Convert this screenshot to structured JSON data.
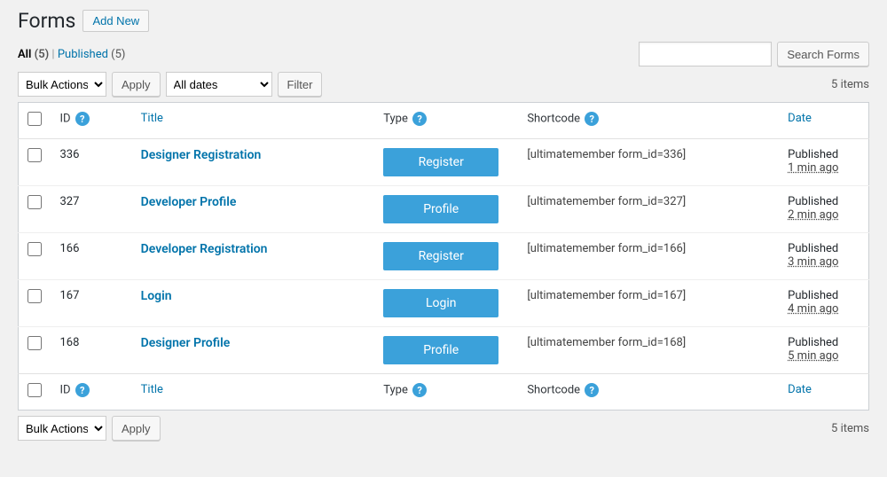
{
  "header": {
    "title": "Forms",
    "add_new": "Add New"
  },
  "status": {
    "all_label": "All",
    "all_count": "(5)",
    "published_label": "Published",
    "published_count": "(5)"
  },
  "search": {
    "placeholder": "",
    "button": "Search Forms"
  },
  "bulk": {
    "label": "Bulk Actions",
    "apply": "Apply"
  },
  "filter": {
    "dates": "All dates",
    "button": "Filter"
  },
  "items_count": "5 items",
  "columns": {
    "id": "ID",
    "title": "Title",
    "type": "Type",
    "shortcode": "Shortcode",
    "date": "Date"
  },
  "rows": [
    {
      "id": "336",
      "title": "Designer Registration",
      "type": "Register",
      "shortcode": "[ultimatemember form_id=336]",
      "status": "Published",
      "time": "1 min ago"
    },
    {
      "id": "327",
      "title": "Developer Profile",
      "type": "Profile",
      "shortcode": "[ultimatemember form_id=327]",
      "status": "Published",
      "time": "2 min ago"
    },
    {
      "id": "166",
      "title": "Developer Registration",
      "type": "Register",
      "shortcode": "[ultimatemember form_id=166]",
      "status": "Published",
      "time": "3 min ago"
    },
    {
      "id": "167",
      "title": "Login",
      "type": "Login",
      "shortcode": "[ultimatemember form_id=167]",
      "status": "Published",
      "time": "4 min ago"
    },
    {
      "id": "168",
      "title": "Designer Profile",
      "type": "Profile",
      "shortcode": "[ultimatemember form_id=168]",
      "status": "Published",
      "time": "5 min ago"
    }
  ]
}
